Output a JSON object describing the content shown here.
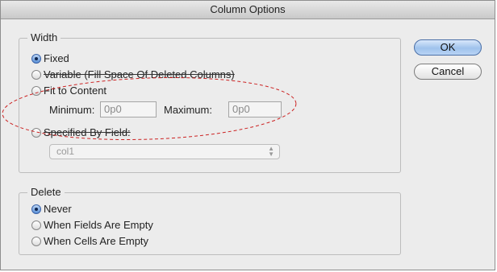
{
  "dialog": {
    "title": "Column Options",
    "ok_label": "OK",
    "cancel_label": "Cancel"
  },
  "width_group": {
    "title": "Width",
    "fixed_label": "Fixed",
    "variable_label": "Variable (Fill Space Of Deleted Columns)",
    "fit_label": "Fit to Content",
    "minimum_label": "Minimum:",
    "minimum_value": "0p0",
    "maximum_label": "Maximum:",
    "maximum_value": "0p0",
    "specified_label": "Specified By Field:",
    "field_select_value": "col1",
    "selected": "Fixed"
  },
  "delete_group": {
    "title": "Delete",
    "never_label": "Never",
    "fields_empty_label": "When Fields Are Empty",
    "cells_empty_label": "When Cells Are Empty",
    "selected": "Never"
  },
  "annotation": {
    "color": "#cc2222"
  }
}
